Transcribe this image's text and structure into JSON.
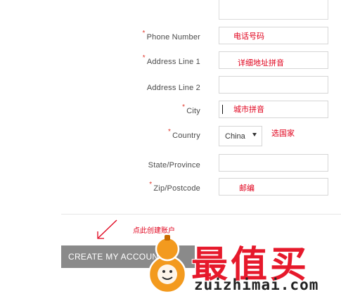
{
  "form": {
    "fields": [
      {
        "id": "phone",
        "label": "Phone Number",
        "required": true,
        "note": "电话号码"
      },
      {
        "id": "address1",
        "label": "Address Line 1",
        "required": true,
        "note": "详细地址拼音"
      },
      {
        "id": "address2",
        "label": "Address Line 2",
        "required": false,
        "note": ""
      },
      {
        "id": "city",
        "label": "City",
        "required": true,
        "note": "城市拼音"
      },
      {
        "id": "country",
        "label": "Country",
        "required": true,
        "value": "China",
        "note": "选国家"
      },
      {
        "id": "state",
        "label": "State/Province",
        "required": false,
        "note": ""
      },
      {
        "id": "zip",
        "label": "Zip/Postcode",
        "required": true,
        "note": "邮编"
      }
    ],
    "required_marker": "*"
  },
  "actions": {
    "create_label": "CREATE MY ACCOUNT",
    "hint": "点此创建账户"
  },
  "watermark": {
    "title": "最值买",
    "site": "zuizhimai.com"
  },
  "colors": {
    "note_red": "#e0001b",
    "required_red": "#e23a2e",
    "button_gray": "#8a8a8a",
    "watermark_red": "#e6192b",
    "logo_orange": "#f39a1e"
  }
}
